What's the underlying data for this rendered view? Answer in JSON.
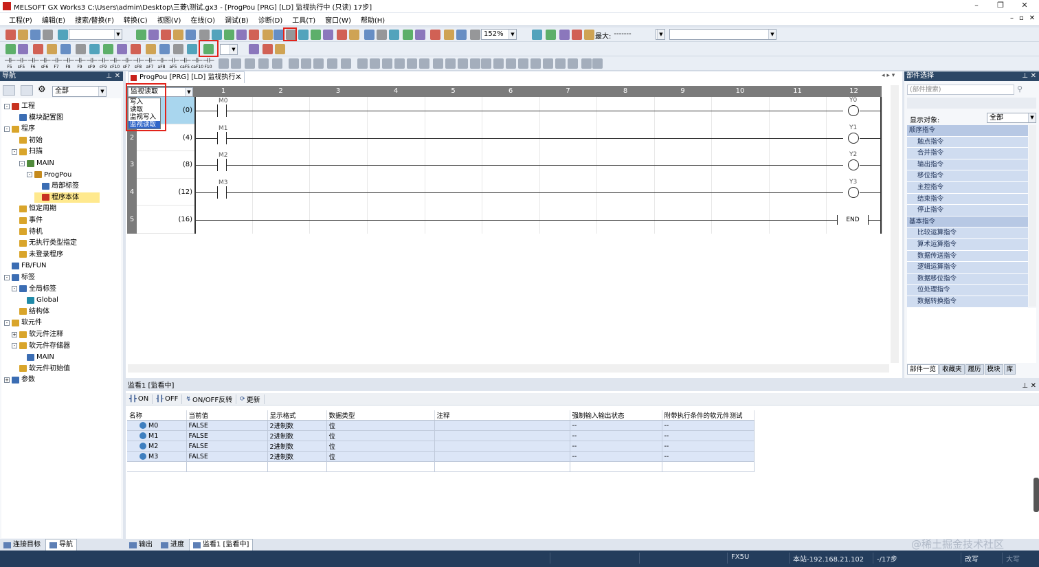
{
  "window": {
    "title": "MELSOFT GX Works3 C:\\Users\\admin\\Desktop\\三菱\\测试.gx3 - [ProgPou [PRG] [LD] 监视执行中 (只读) 17步]",
    "controls": [
      "–",
      "❐",
      "✕"
    ],
    "doc_controls": [
      "–",
      "▫",
      "✕"
    ]
  },
  "menu": [
    "工程(P)",
    "编辑(E)",
    "搜索/替换(F)",
    "转换(C)",
    "视图(V)",
    "在线(O)",
    "调试(B)",
    "诊断(D)",
    "工具(T)",
    "窗口(W)",
    "帮助(H)"
  ],
  "toolbar": {
    "zoom": "152%",
    "max_label": "最大:",
    "max_value": "-------",
    "fkeys": [
      "F5",
      "sF5",
      "F6",
      "sF6",
      "F7",
      "F8",
      "F9",
      "sF9",
      "cF9",
      "cF10",
      "sF7",
      "sF8",
      "aF7",
      "aF8",
      "aF5",
      "caF5",
      "caF10",
      "F10"
    ]
  },
  "navigation": {
    "title": "导航",
    "filter": "全部",
    "tree": [
      {
        "label": "工程",
        "level": 0,
        "toggle": "-",
        "icon": "project-icon"
      },
      {
        "label": "模块配置图",
        "level": 1,
        "toggle": "",
        "icon": "module-config-icon"
      },
      {
        "label": "程序",
        "level": 0,
        "toggle": "-",
        "icon": "program-folder-icon"
      },
      {
        "label": "初始",
        "level": 1,
        "toggle": "",
        "icon": "folder-icon"
      },
      {
        "label": "扫描",
        "level": 1,
        "toggle": "-",
        "icon": "folder-icon"
      },
      {
        "label": "MAIN",
        "level": 2,
        "toggle": "-",
        "icon": "program-icon"
      },
      {
        "label": "ProgPou",
        "level": 3,
        "toggle": "-",
        "icon": "pou-icon"
      },
      {
        "label": "局部标签",
        "level": 4,
        "toggle": "",
        "icon": "label-icon"
      },
      {
        "label": "程序本体",
        "level": 4,
        "toggle": "",
        "icon": "program-body-icon",
        "selected": true
      },
      {
        "label": "恒定周期",
        "level": 1,
        "toggle": "",
        "icon": "folder-icon"
      },
      {
        "label": "事件",
        "level": 1,
        "toggle": "",
        "icon": "folder-icon"
      },
      {
        "label": "待机",
        "level": 1,
        "toggle": "",
        "icon": "folder-icon"
      },
      {
        "label": "无执行类型指定",
        "level": 1,
        "toggle": "",
        "icon": "folder-icon"
      },
      {
        "label": "未登录程序",
        "level": 1,
        "toggle": "",
        "icon": "folder-icon"
      },
      {
        "label": "FB/FUN",
        "level": 0,
        "toggle": "",
        "icon": "fbfun-icon"
      },
      {
        "label": "标签",
        "level": 0,
        "toggle": "-",
        "icon": "label-folder-icon"
      },
      {
        "label": "全局标签",
        "level": 1,
        "toggle": "-",
        "icon": "global-label-icon"
      },
      {
        "label": "Global",
        "level": 2,
        "toggle": "",
        "icon": "global-icon"
      },
      {
        "label": "结构体",
        "level": 1,
        "toggle": "",
        "icon": "struct-icon"
      },
      {
        "label": "软元件",
        "level": 0,
        "toggle": "-",
        "icon": "device-folder-icon"
      },
      {
        "label": "软元件注释",
        "level": 1,
        "toggle": "+",
        "icon": "device-comment-icon"
      },
      {
        "label": "软元件存储器",
        "level": 1,
        "toggle": "-",
        "icon": "device-memory-icon"
      },
      {
        "label": "MAIN",
        "level": 2,
        "toggle": "",
        "icon": "memory-icon"
      },
      {
        "label": "软元件初始值",
        "level": 1,
        "toggle": "",
        "icon": "device-init-icon"
      },
      {
        "label": "参数",
        "level": 0,
        "toggle": "+",
        "icon": "parameter-icon"
      }
    ]
  },
  "editor": {
    "tab_label": "ProgPou [PRG] [LD] 监视执行...",
    "mode_combo": "监视读取",
    "mode_options": [
      "写入",
      "读取",
      "监视写入",
      "监视读取"
    ],
    "columns": [
      "1",
      "2",
      "3",
      "4",
      "5",
      "6",
      "7",
      "8",
      "9",
      "10",
      "11",
      "12"
    ],
    "rungs": [
      {
        "row": "1",
        "step": "(0)",
        "contact": "M0",
        "coil": "Y0"
      },
      {
        "row": "2",
        "step": "(4)",
        "contact": "M1",
        "coil": "Y1"
      },
      {
        "row": "3",
        "step": "(8)",
        "contact": "M2",
        "coil": "Y2"
      },
      {
        "row": "4",
        "step": "(12)",
        "contact": "M3",
        "coil": "Y3"
      },
      {
        "row": "5",
        "step": "(16)",
        "end": "END"
      }
    ]
  },
  "parts": {
    "title": "部件选择",
    "search_placeholder": "(部件搜索)",
    "display_target_label": "显示对象:",
    "display_target_value": "全部",
    "items": [
      {
        "label": "顺序指令",
        "cat": true
      },
      {
        "label": "触点指令"
      },
      {
        "label": "合并指令"
      },
      {
        "label": "输出指令"
      },
      {
        "label": "移位指令"
      },
      {
        "label": "主控指令"
      },
      {
        "label": "结束指令"
      },
      {
        "label": "停止指令"
      },
      {
        "label": "基本指令",
        "cat": true
      },
      {
        "label": "比较运算指令"
      },
      {
        "label": "算术运算指令"
      },
      {
        "label": "数据传送指令"
      },
      {
        "label": "逻辑运算指令"
      },
      {
        "label": "数据移位指令"
      },
      {
        "label": "位处理指令"
      },
      {
        "label": "数据转换指令"
      }
    ],
    "tabs": [
      "部件一览",
      "收藏夹",
      "履历",
      "模块",
      "库"
    ]
  },
  "watch": {
    "title": "监看1 [监看中]",
    "toolbar": [
      "ON",
      "OFF",
      "ON/OFF反转",
      "更新"
    ],
    "headers": [
      "名称",
      "当前值",
      "显示格式",
      "数据类型",
      "注释",
      "强制输入输出状态",
      "附带执行条件的软元件测试"
    ],
    "rows": [
      [
        "M0",
        "FALSE",
        "2进制数",
        "位",
        "",
        "--",
        "--"
      ],
      [
        "M1",
        "FALSE",
        "2进制数",
        "位",
        "",
        "--",
        "--"
      ],
      [
        "M2",
        "FALSE",
        "2进制数",
        "位",
        "",
        "--",
        "--"
      ],
      [
        "M3",
        "FALSE",
        "2进制数",
        "位",
        "",
        "--",
        "--"
      ]
    ]
  },
  "bottom_tabs_left": [
    "连接目标",
    "导航"
  ],
  "bottom_tabs_right": [
    "输出",
    "进度",
    "监看1 [监看中]"
  ],
  "status": {
    "cpu": "FX5U",
    "connection": "本站-192.168.21.102",
    "steps": "-/17步",
    "mode": "改写",
    "caps": "大写",
    "watermark": "@稀土掘金技术社区"
  }
}
